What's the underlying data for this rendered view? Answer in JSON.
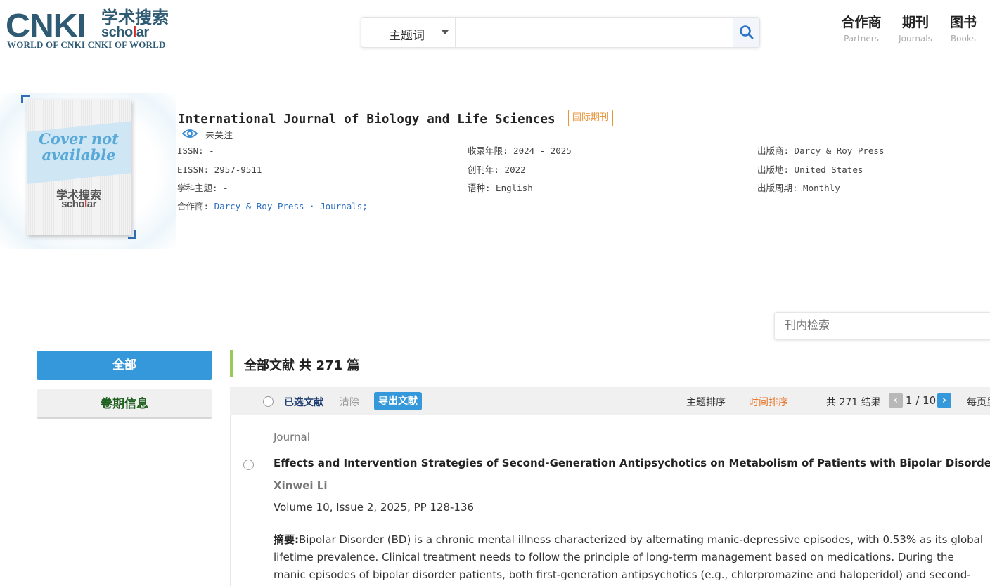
{
  "header": {
    "logo": {
      "mark": "CNKI",
      "cn": "学术搜索",
      "scholar_pre": "scho",
      "scholar_dot": "l",
      "scholar_post": "ar",
      "slogan": "WORLD OF CNKI CNKI OF WORLD"
    },
    "search": {
      "field_label": "主题词",
      "query": ""
    },
    "nav": [
      {
        "cn": "合作商",
        "en": "Partners"
      },
      {
        "cn": "期刊",
        "en": "Journals"
      },
      {
        "cn": "图书",
        "en": "Books"
      }
    ]
  },
  "journal": {
    "cover": {
      "line1": "Cover not",
      "line2": "available",
      "logo_cn": "学术搜索",
      "logo_pre": "scho",
      "logo_dot": "l",
      "logo_post": "ar"
    },
    "title": "International Journal of Biology and Life Sciences",
    "badge": "国际期刊",
    "follow_label": "未关注",
    "meta": {
      "issn": "ISSN: -",
      "eissn": "EISSN: 2957-9511",
      "subject": "学科主题: -",
      "partner_label": "合作商: ",
      "partner_value": "Darcy & Roy Press · Journals;",
      "coverage": "收录年限: 2024 - 2025",
      "founded": "创刊年: 2022",
      "language": "语种: English",
      "publisher": "出版商: Darcy & Roy Press",
      "place": "出版地: United States",
      "frequency": "出版周期: Monthly"
    }
  },
  "inner_search": {
    "placeholder": "刊内检索"
  },
  "sidebar": {
    "all_label": "全部",
    "volume_label": "卷期信息"
  },
  "results": {
    "heading": "全部文献 共 271 篇",
    "toolbar": {
      "selected_label": "已选文献",
      "clear_label": "清除",
      "export_label": "导出文献",
      "sort_topic": "主题排序",
      "sort_time": "时间排序",
      "total_label": "共 271 结果",
      "page_current": "1",
      "page_total": "10",
      "per_page_label": "每页显示"
    },
    "items": [
      {
        "type": "Journal",
        "title": "Effects and Intervention Strategies of Second-Generation Antipsychotics on Metabolism of Patients with Bipolar Disorder",
        "author": "Xinwei Li",
        "source": "Volume 10, Issue 2, 2025, PP 128-136",
        "abstract_label": "摘要:",
        "abstract": "Bipolar Disorder (BD) is a chronic mental illness characterized by alternating manic-depressive episodes, with 0.53% as its global lifetime prevalence. Clinical treatment needs to follow the principle of long-term management based on medications. During the manic episodes of bipolar disorder patients, both first-generation antipsychotics (e.g., chlorpromazine and haloperidol) and second-generation antipsychotics..."
      }
    ]
  },
  "colors": {
    "brand": "#2e5a73",
    "accent_blue": "#3498db",
    "link_blue": "#2b6fc1",
    "badge_orange": "#e8953b",
    "sort_active": "#e8772e",
    "section_green": "#9ac85a"
  },
  "icons": {
    "search": "search-icon",
    "eye": "eye-icon",
    "caret": "chevron-down-icon",
    "prev": "chevron-left-icon",
    "next": "chevron-right-icon"
  }
}
